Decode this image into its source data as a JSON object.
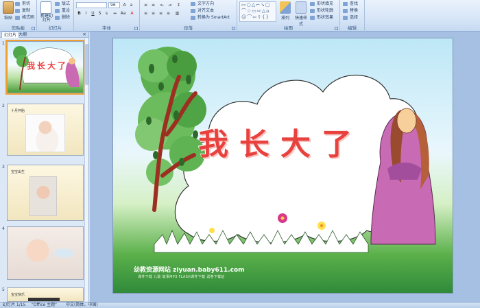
{
  "ribbon": {
    "clipboard": {
      "label": "剪贴板",
      "paste": "粘贴",
      "cut": "剪切",
      "copy": "复制",
      "format_painter": "格式刷"
    },
    "slides": {
      "label": "幻灯片",
      "new_slide": "新建幻灯片",
      "layout": "版式",
      "reset": "重设",
      "delete": "删除"
    },
    "font": {
      "label": "字体",
      "font_name": "",
      "font_size": "96"
    },
    "paragraph": {
      "label": "段落",
      "text_direction": "文字方向",
      "align_text": "对齐文本",
      "smartart": "转换为 SmartArt"
    },
    "drawing": {
      "label": "绘图",
      "arrange": "排列",
      "quick_styles": "快速样式",
      "shape_fill": "形状填充",
      "shape_outline": "形状轮廓",
      "shape_effects": "形状效果"
    },
    "editing": {
      "label": "编辑",
      "find": "查找",
      "replace": "替换",
      "select": "选择"
    }
  },
  "panel": {
    "tab_slides": "幻灯片",
    "tab_outline": "大纲",
    "close": "×",
    "thumbnails": [
      {
        "num": "1",
        "title": "我长大了"
      },
      {
        "num": "2",
        "title": "十月怀胎"
      },
      {
        "num": "3",
        "title": "宝宝出生"
      },
      {
        "num": "4",
        "title": ""
      },
      {
        "num": "5",
        "title": "宝宝快乐"
      }
    ]
  },
  "slide": {
    "title": "我长大了",
    "site": "幼教资源网站 ziyuan.baby611.com",
    "sub": "课件下载  儿歌  故事MP3  FLASH课件下载  试卷下载站"
  },
  "status": {
    "slide_count": "幻灯片 1/15",
    "theme": "\"Office 主题\"",
    "language": "中文(简体，中国)"
  },
  "colors": {
    "accent": "#f0a030",
    "title_red": "#e8413e",
    "ribbon_bg": "#d3e3f6"
  }
}
